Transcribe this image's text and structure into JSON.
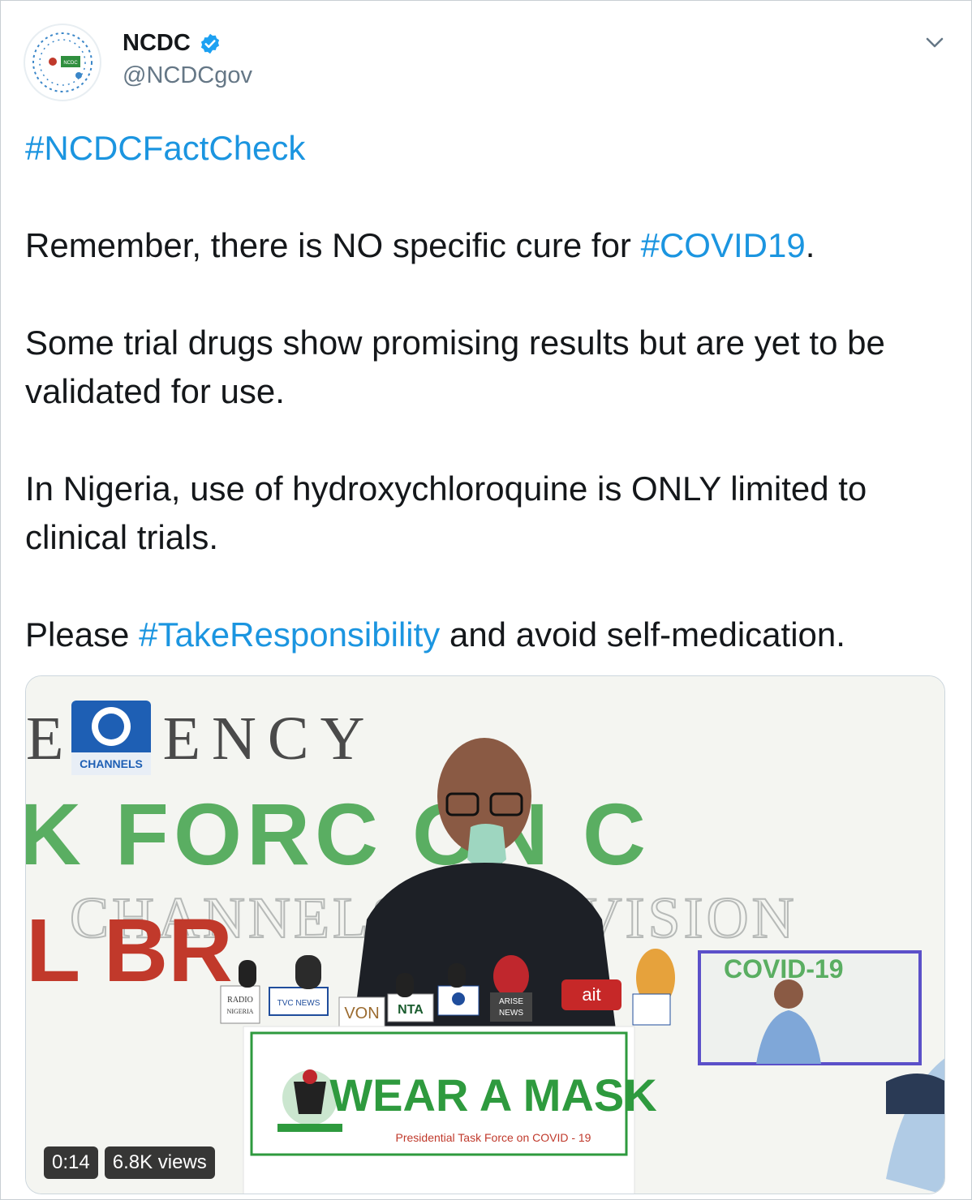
{
  "author": {
    "display_name": "NCDC",
    "handle": "@NCDCgov",
    "verified": true,
    "avatar_label": "NCDC"
  },
  "icons": {
    "verified": "verified-badge-icon",
    "caret": "chevron-down-icon"
  },
  "tweet": {
    "paragraphs": [
      [
        {
          "text": "#NCDCFactCheck",
          "link": true
        }
      ],
      [
        {
          "text": "Remember, there is NO specific cure for ",
          "link": false
        },
        {
          "text": "#COVID19",
          "link": true
        },
        {
          "text": ".",
          "link": false
        }
      ],
      [
        {
          "text": "Some trial drugs show promising results but are yet to be validated for use.",
          "link": false
        }
      ],
      [
        {
          "text": "In Nigeria, use of hydroxychloroquine is ONLY limited to clinical trials.",
          "link": false
        }
      ],
      [
        {
          "text": "Please ",
          "link": false
        },
        {
          "text": "#TakeResponsibility",
          "link": true
        },
        {
          "text": " and avoid self-medication.",
          "link": false
        }
      ]
    ]
  },
  "media": {
    "banner_top": "EIDENCY",
    "banner_mid": "K FORC  ON C",
    "watermark": "CHANNELS TELEVISION",
    "channel_logo": "CHANNELS",
    "podium_sign": "WEAR A MASK",
    "podium_sub": "Presidential Task Force on COVID - 19",
    "inset_label": "COVID-19",
    "mic_labels": [
      "RADIO NIGERIA",
      "TVC NEWS",
      "VON",
      "NTA",
      "CHANNELS",
      "ARISE NEWS",
      "ait"
    ],
    "duration": "0:14",
    "views": "6.8K views"
  },
  "colors": {
    "link": "#1b95e0",
    "verified": "#1da1f2",
    "handle": "#657786",
    "banner_green": "#5aae62",
    "sign_green": "#2e9a3e"
  }
}
